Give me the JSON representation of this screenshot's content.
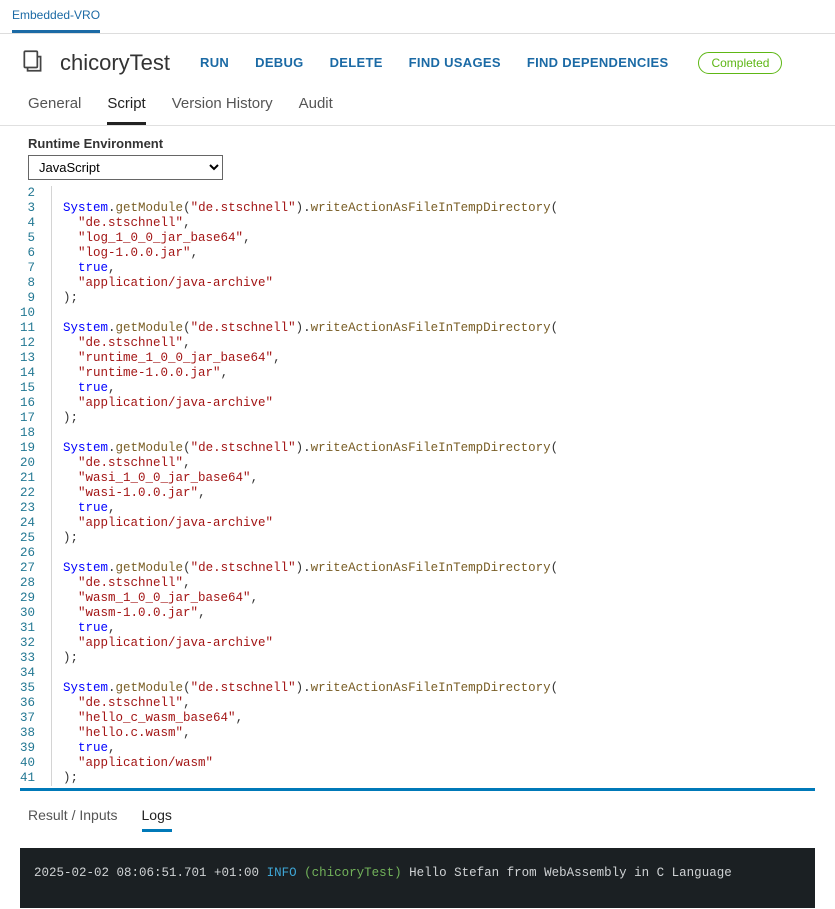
{
  "topbar": {
    "tab": "Embedded-VRO"
  },
  "header": {
    "title": "chicoryTest",
    "actions": {
      "run": "RUN",
      "debug": "DEBUG",
      "delete": "DELETE",
      "findUsages": "FIND USAGES",
      "findDependencies": "FIND DEPENDENCIES"
    },
    "status": "Completed"
  },
  "tabs": {
    "general": "General",
    "script": "Script",
    "versionHistory": "Version History",
    "audit": "Audit"
  },
  "runtime": {
    "label": "Runtime Environment",
    "value": "JavaScript"
  },
  "code": {
    "obj": "System",
    "getModule": "getModule",
    "writeAction": "writeActionAsFileInTempDirectory",
    "modulePkg": "\"de.stschnell\"",
    "true": "true",
    "mimeJar": "\"application/java-archive\"",
    "mimeWasm": "\"application/wasm\"",
    "closeParen": ");",
    "startLine": 2,
    "blocks": [
      {
        "arg2": "\"log_1_0_0_jar_base64\"",
        "arg3": "\"log-1.0.0.jar\"",
        "mime": "mimeJar"
      },
      {
        "arg2": "\"runtime_1_0_0_jar_base64\"",
        "arg3": "\"runtime-1.0.0.jar\"",
        "mime": "mimeJar"
      },
      {
        "arg2": "\"wasi_1_0_0_jar_base64\"",
        "arg3": "\"wasi-1.0.0.jar\"",
        "mime": "mimeJar"
      },
      {
        "arg2": "\"wasm_1_0_0_jar_base64\"",
        "arg3": "\"wasm-1.0.0.jar\"",
        "mime": "mimeJar"
      },
      {
        "arg2": "\"hello_c_wasm_base64\"",
        "arg3": "\"hello.c.wasm\"",
        "mime": "mimeWasm"
      }
    ]
  },
  "bottomTabs": {
    "result": "Result / Inputs",
    "logs": "Logs"
  },
  "console": {
    "timestamp": "2025-02-02 08:06:51.701 +01:00",
    "level": "INFO",
    "name": "(chicoryTest)",
    "message": "Hello Stefan from WebAssembly in C Language"
  }
}
